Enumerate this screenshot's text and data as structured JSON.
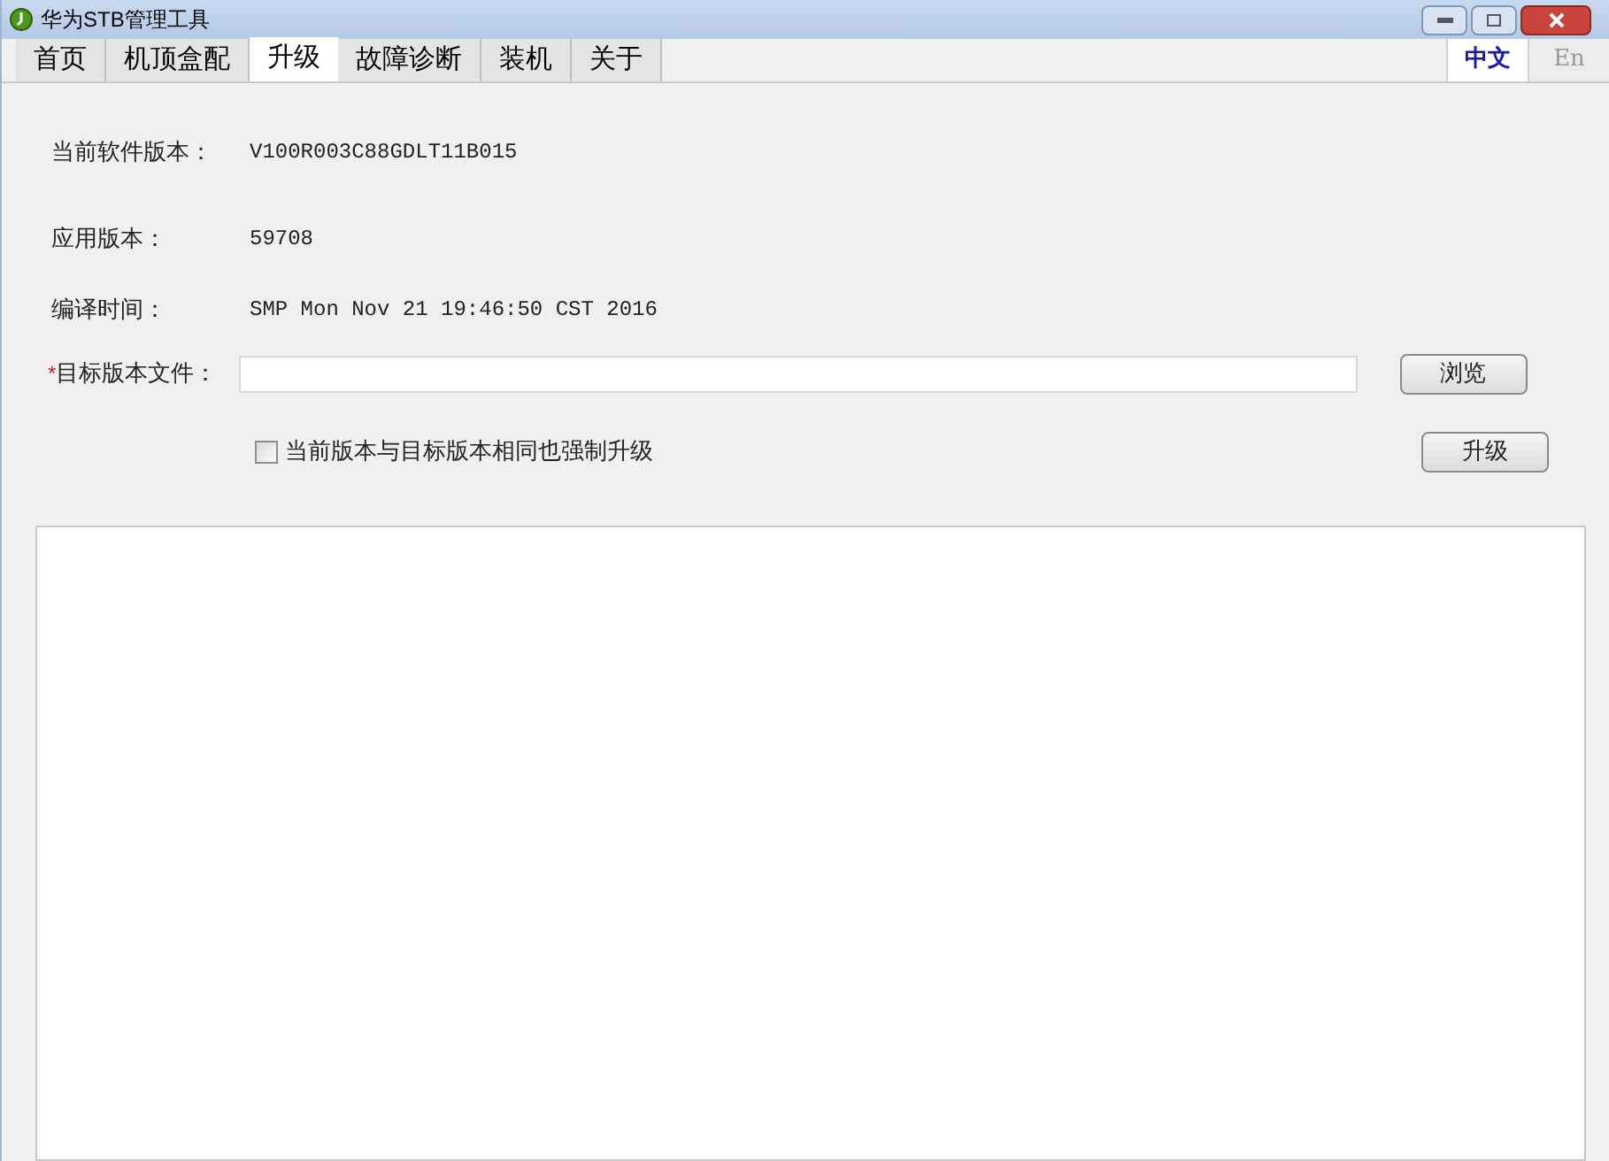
{
  "window": {
    "title": "华为STB管理工具"
  },
  "tabs": [
    {
      "label": "首页",
      "selected": false
    },
    {
      "label": "机顶盒配",
      "selected": false
    },
    {
      "label": "升级",
      "selected": true
    },
    {
      "label": "故障诊断",
      "selected": false
    },
    {
      "label": "装机",
      "selected": false
    },
    {
      "label": "关于",
      "selected": false
    }
  ],
  "languages": [
    {
      "label": "中文",
      "selected": true
    },
    {
      "label": "En",
      "selected": false
    }
  ],
  "info": [
    {
      "label": "当前软件版本：",
      "value": "V100R003C88GDLT11B015"
    },
    {
      "label": "应用版本：",
      "value": "59708"
    },
    {
      "label": "编译时间：",
      "value": "SMP Mon Nov 21 19:46:50 CST 2016"
    }
  ],
  "target_file": {
    "required_mark": "*",
    "label": "目标版本文件：",
    "browse_button": "浏览"
  },
  "force_upgrade": {
    "label": "当前版本与目标版本相同也强制升级",
    "checked": false
  },
  "upgrade_button": "升级"
}
